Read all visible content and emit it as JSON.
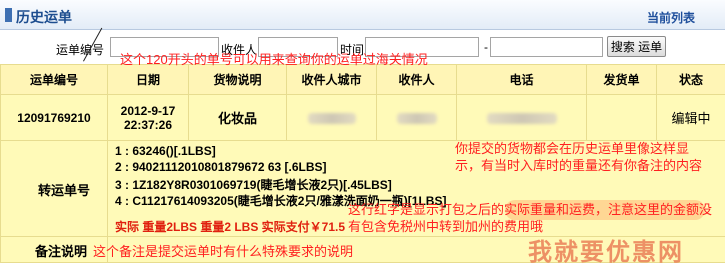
{
  "header": {
    "title": "历史运单",
    "link_label": "当前列表"
  },
  "search": {
    "waybill_label": "运单编号",
    "recipient_label": "收件人",
    "time_label": "时间",
    "dash": "-",
    "button_label": "搜索 运单"
  },
  "notes": {
    "waybill_hint": "这个120开头的单号可以用来查询你的运单过海关情况",
    "history_hint": "你提交的货物都会在历史运单里像这样显示，有当时入库时的重量还有你备注的内容",
    "red_text_hint": "这行红字是显示打包之后的实际重量和运费，注意这里的金额没有包含免税州中转到加州的费用哦",
    "remark_hint": "这个备注是提交运单时有什么特殊要求的说明"
  },
  "table": {
    "headers": [
      "运单编号",
      "日期",
      "货物说明",
      "收件人城市",
      "收件人",
      "电话",
      "发货单",
      "状态"
    ],
    "row": {
      "waybill_no": "12091769210",
      "date": "2012-9-17",
      "time": "22:37:26",
      "goods": "化妆品",
      "status": "编辑中"
    }
  },
  "transfer": {
    "label": "转运单号",
    "lines": [
      "1 : 63246()[.1LBS]",
      "2 : 94021112010801879672 63 [.6LBS]",
      "3 : 1Z182Y8R0301069719(睫毛增长液2只)[.45LBS]",
      "4 : C11217614093205(睫毛增长液2只/雅漾洗面奶一瓶)[1LBS]"
    ],
    "price_line": "实际 重量2LBS  重量2 LBS 实际支付￥71.5"
  },
  "remark": {
    "label": "备注说明"
  },
  "watermark": "我就要优惠网"
}
